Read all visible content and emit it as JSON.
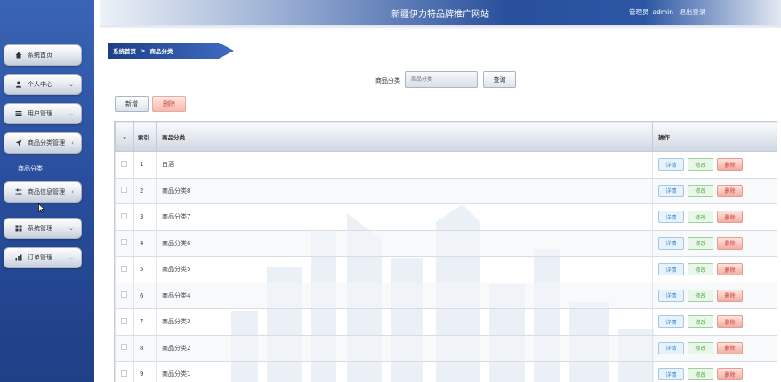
{
  "header": {
    "site_title": "新疆伊力特品牌推广网站",
    "user_label": "管理员",
    "username": "admin",
    "logout": "退出登录"
  },
  "sidebar": {
    "items": [
      {
        "label": "系统首页",
        "icon": "home-icon"
      },
      {
        "label": "个人中心",
        "icon": "person-icon"
      },
      {
        "label": "用户管理",
        "icon": "list-icon"
      },
      {
        "label": "商品分类管理",
        "icon": "send-icon"
      },
      {
        "label": "商品信息管理",
        "icon": "sliders-icon"
      },
      {
        "label": "系统管理",
        "icon": "grid-icon"
      },
      {
        "label": "订单管理",
        "icon": "chart-icon"
      }
    ],
    "sub_item": "商品分类"
  },
  "breadcrumb": {
    "home": "系统首页",
    "separator": ">",
    "current": "商品分类"
  },
  "search": {
    "label": "商品分类",
    "placeholder": "商品分类",
    "button": "查询"
  },
  "actions": {
    "add": "新增",
    "delete": "删除"
  },
  "table": {
    "headers": {
      "index": "索引",
      "category": "商品分类",
      "ops": "操作"
    },
    "rows": [
      {
        "index": "1",
        "category": "白酒"
      },
      {
        "index": "2",
        "category": "商品分类8"
      },
      {
        "index": "3",
        "category": "商品分类7"
      },
      {
        "index": "4",
        "category": "商品分类6"
      },
      {
        "index": "5",
        "category": "商品分类5"
      },
      {
        "index": "6",
        "category": "商品分类4"
      },
      {
        "index": "7",
        "category": "商品分类3"
      },
      {
        "index": "8",
        "category": "商品分类2"
      },
      {
        "index": "9",
        "category": "商品分类1"
      }
    ],
    "op_labels": {
      "detail": "详情",
      "edit": "修改",
      "delete": "删除"
    }
  },
  "colors": {
    "sidebar": "#2a4f9e",
    "breadcrumb": "#1d3f86",
    "danger": "#c43c30",
    "success": "#54a34d",
    "info": "#3a86c8"
  }
}
